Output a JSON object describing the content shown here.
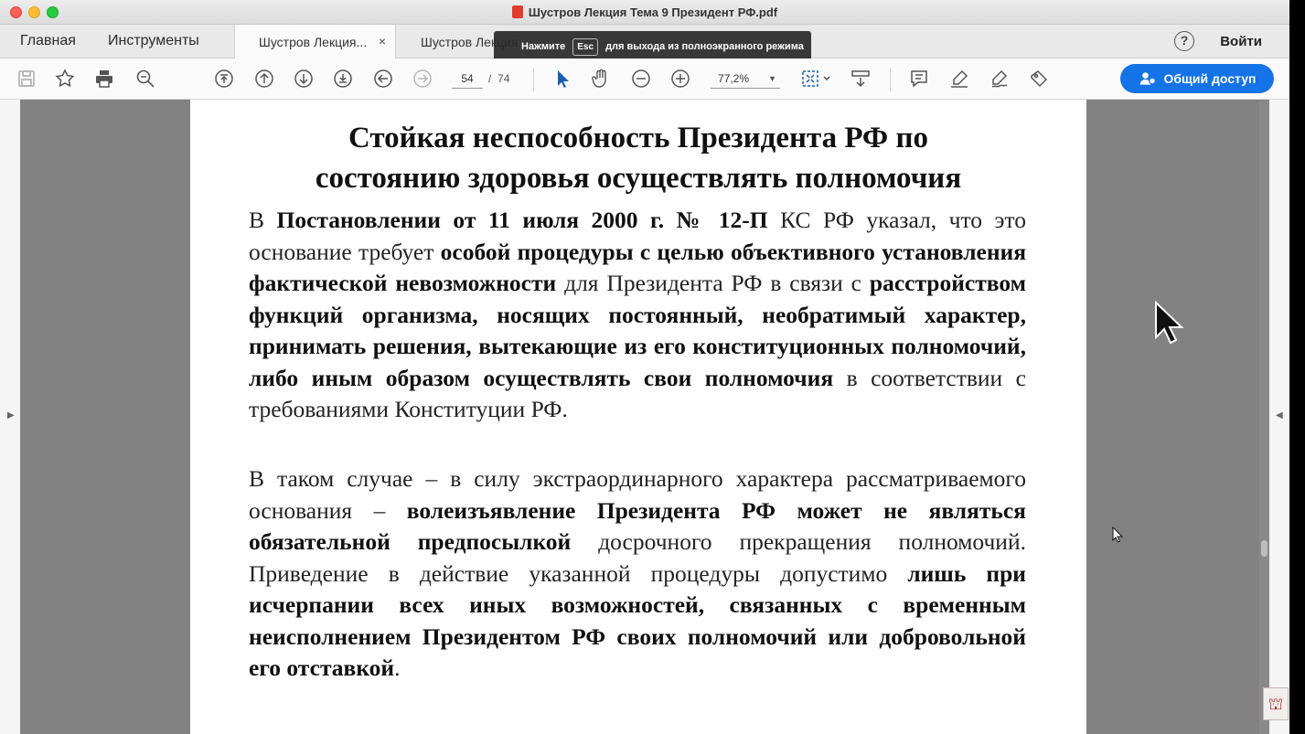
{
  "window": {
    "title": "Шустров Лекция Тема 9 Президент РФ.pdf"
  },
  "menu_tabs": [
    {
      "label": "Главная"
    },
    {
      "label": "Инструменты"
    }
  ],
  "doc_tabs": [
    {
      "label": "Шустров Лекция...",
      "close": "×"
    },
    {
      "label": "Шустров Лекция"
    }
  ],
  "header": {
    "help": "?",
    "login": "Войти"
  },
  "fullscreen_notice": {
    "before": "Нажмите",
    "key": "Esc",
    "after": "для выхода из полноэкранного режима"
  },
  "toolbar": {
    "page_current": "54",
    "page_sep": "/",
    "page_total": "74",
    "zoom": "77,2%",
    "share_label": "Общий доступ"
  },
  "document": {
    "title_line1": "Стойкая неспособность Президента РФ по",
    "title_line2": "состоянию здоровья осуществлять полномочия",
    "p1": [
      {
        "t": "В ",
        "b": false
      },
      {
        "t": "Постановлении от 11 июля 2000 г. № 12-П",
        "b": true
      },
      {
        "t": " КС РФ указал, что это основание требует ",
        "b": false
      },
      {
        "t": "особой процедуры с целью объективного установления фактической невозможности",
        "b": true
      },
      {
        "t": " для Президента РФ в связи с ",
        "b": false
      },
      {
        "t": "расстройством функций организма, носящих постоянный, необратимый характер, принимать решения, вытекающие из его конституционных полномочий, либо иным образом осуществлять свои полномочия",
        "b": true
      },
      {
        "t": " в соответствии с требованиями Конституции РФ.",
        "b": false
      }
    ],
    "p2": [
      {
        "t": "В таком случае – в силу экстраординарного характера рассматриваемого основания – ",
        "b": false
      },
      {
        "t": "волеизъявление Президента РФ может не являться обязательной предпосылкой",
        "b": true
      },
      {
        "t": " досрочного прекращения полномочий. Приведение в действие указанной процедуры допустимо ",
        "b": false
      },
      {
        "t": "лишь при исчерпании всех иных возможностей, связанных с временным неисполнением Президентом РФ своих полномочий или добровольной его отставкой",
        "b": true
      },
      {
        "t": ".",
        "b": false
      }
    ]
  },
  "icons": [
    "save-icon",
    "bookmark-star-icon",
    "print-icon",
    "zoom-search-icon",
    "first-page-icon",
    "prev-page-icon",
    "next-page-icon",
    "last-page-icon",
    "back-icon",
    "forward-icon",
    "select-arrow-icon",
    "hand-icon",
    "zoom-out-icon",
    "zoom-in-icon",
    "fit-page-icon",
    "scroll-mode-icon",
    "comment-icon",
    "highlight-icon",
    "sign-icon",
    "stamp-icon",
    "share-user-icon"
  ]
}
